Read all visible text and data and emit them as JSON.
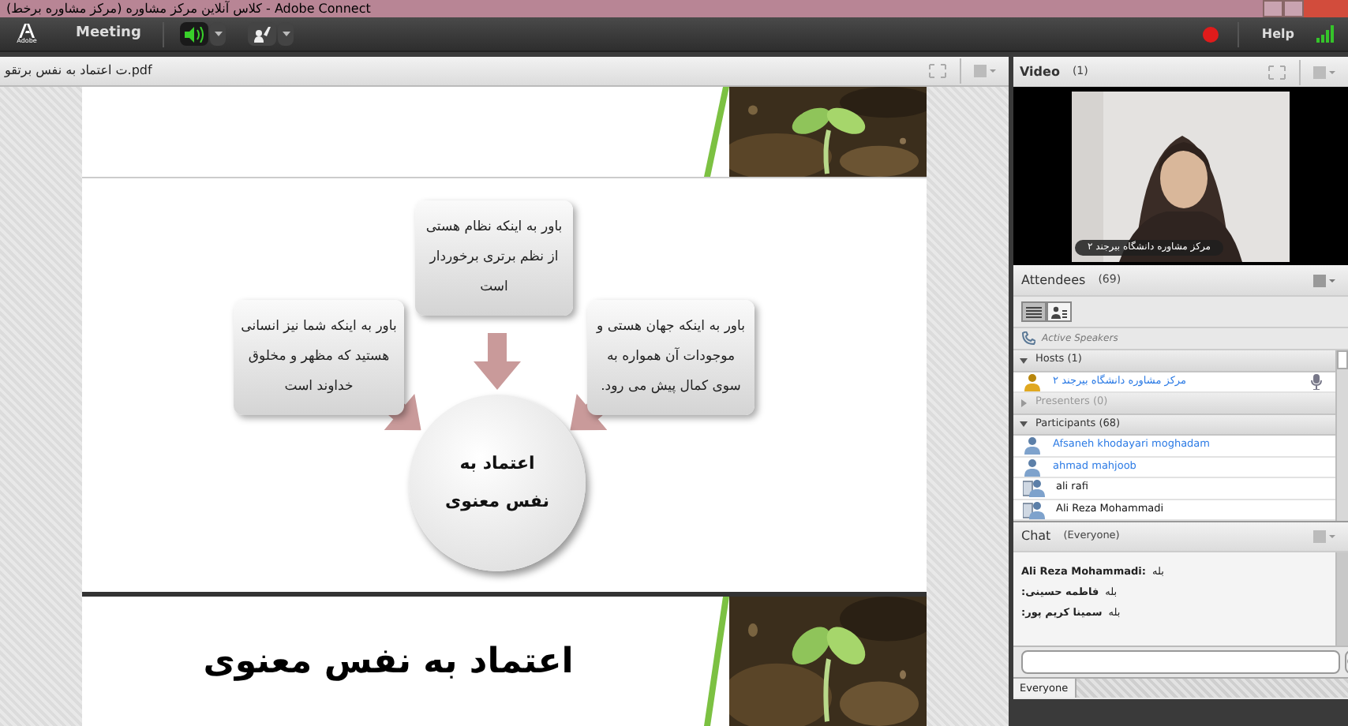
{
  "title_bar": {
    "title": "(کلاس آنلاین مرکز مشاوره (مرکز مشاوره برخط - Adobe Connect"
  },
  "toolbar": {
    "logo_text": "Adobe",
    "meeting_menu": "Meeting",
    "speaker_on": true,
    "recording": true,
    "help": "Help"
  },
  "share_pod": {
    "file_name": "ت اعتماد به نفس برتقو.pdf",
    "diagram": {
      "top_box": "باور به اینکه نظام هستی از نظم برتری برخوردار است",
      "left_box": "باور به اینکه شما نیز انسانی هستید که مظهر و مخلوق خداوند است",
      "right_box": "باور به اینکه جهان هستی و موجودات آن همواره به سوی کمال پیش می رود.",
      "center": "اعتماد به نفس معنوی"
    },
    "next_slide_title": "اعتماد به نفس معنوی"
  },
  "video_pod": {
    "title": "Video",
    "count": "(1)",
    "caption": "مرکز مشاوره دانشگاه بیرجند ۲"
  },
  "attendees": {
    "title": "Attendees",
    "count": "(69)",
    "active_speakers": "Active Speakers",
    "groups": [
      {
        "name": "Hosts (1)",
        "expanded": true,
        "members": [
          {
            "name": "مرکز مشاوره دانشگاه بیرجند ۲",
            "kind": "host"
          }
        ]
      },
      {
        "name": "Presenters (0)",
        "expanded": false
      },
      {
        "name": "Participants (68)",
        "expanded": true,
        "members": [
          {
            "name": "Afsaneh khodayari moghadam",
            "kind": "registered"
          },
          {
            "name": "ahmad mahjoob",
            "kind": "registered"
          },
          {
            "name": "ali rafi",
            "kind": "guest"
          },
          {
            "name": "Ali Reza Mohammadi",
            "kind": "guest"
          }
        ]
      }
    ]
  },
  "chat": {
    "title": "Chat",
    "scope": "(Everyone)",
    "messages": [
      {
        "sender": "Ali Reza Mohammadi:",
        "text": "بله"
      },
      {
        "sender": "فاطمه حسینی:",
        "text": "بله"
      },
      {
        "sender": "سمینا کریم پور:",
        "text": "بله"
      }
    ],
    "tab": "Everyone"
  }
}
